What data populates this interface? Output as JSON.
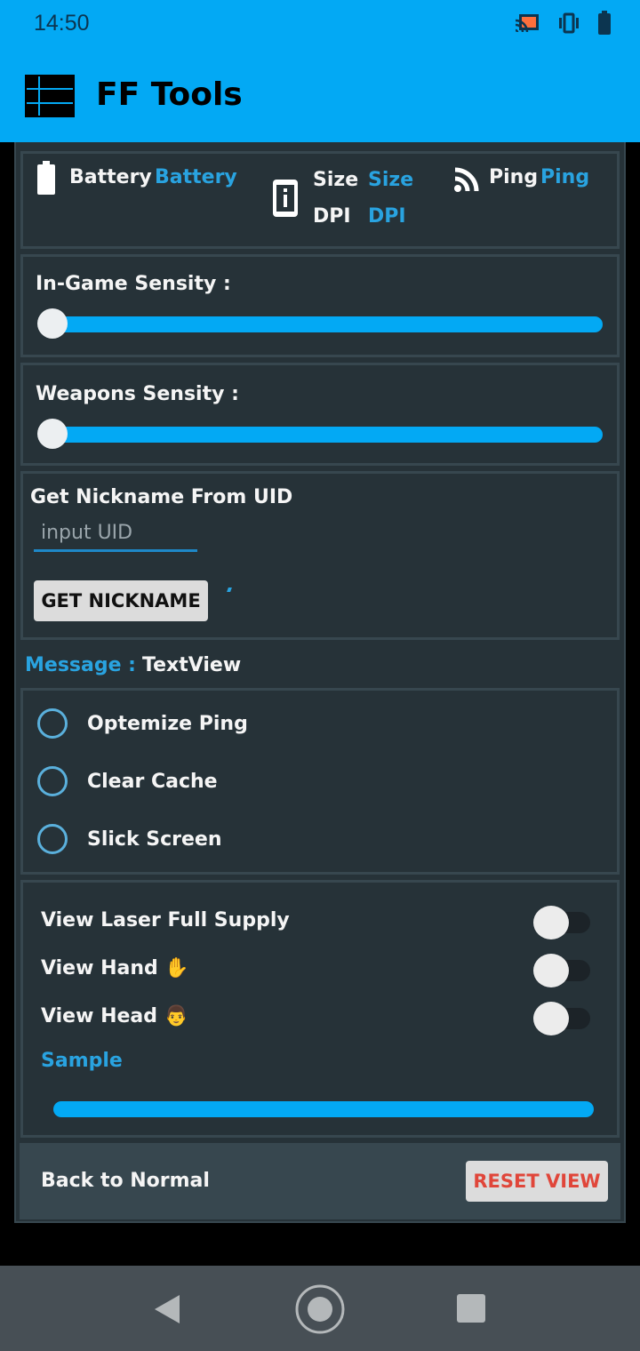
{
  "status_bar": {
    "time": "14:50",
    "icons": [
      "cast-icon",
      "vibrate-icon",
      "battery-icon"
    ]
  },
  "app_bar": {
    "title": "FF Tools",
    "menu_icon": "list-menu-icon"
  },
  "device_info": {
    "battery_label": "Battery",
    "battery_value": "Battery",
    "size_label": "Size",
    "size_value": "Size",
    "dpi_label": "DPI",
    "dpi_value": "DPI",
    "ping_label": "Ping",
    "ping_value": "Ping"
  },
  "sliders": [
    {
      "label": "In-Game Sensity :",
      "value_fraction": 0.0
    },
    {
      "label": "Weapons Sensity :",
      "value_fraction": 0.0
    }
  ],
  "nickname": {
    "title": "Get Nickname From UID",
    "input_placeholder": "input UID",
    "input_value": "",
    "button_label": "GET NICKNAME"
  },
  "message": {
    "label": "Message :",
    "value": "TextView"
  },
  "options": [
    {
      "label": "Optemize Ping",
      "checked": false
    },
    {
      "label": "Clear Cache",
      "checked": false
    },
    {
      "label": "Slick Screen",
      "checked": false
    }
  ],
  "toggles": [
    {
      "label": "View Laser Full Supply",
      "on": false
    },
    {
      "label": "View Hand ✋",
      "on": false
    },
    {
      "label": "View Head 👨",
      "on": false
    }
  ],
  "sample": {
    "label": "Sample",
    "progress_fraction": 1.0
  },
  "footer": {
    "label": "Back to Normal",
    "reset_button": "RESET VIEW"
  },
  "colors": {
    "accent": "#03a9f4",
    "card_bg": "#263238",
    "reset_text": "#e0463a"
  }
}
